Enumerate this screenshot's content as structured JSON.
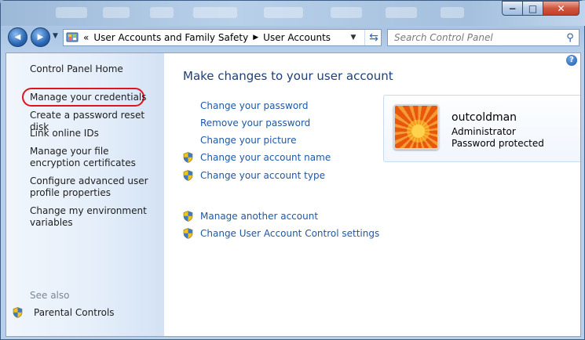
{
  "window": {
    "caption_min": "−",
    "caption_max": "□",
    "caption_close": "✕"
  },
  "nav": {
    "back_glyph": "◀",
    "forward_glyph": "▶",
    "breadcrumb_prefix": "«",
    "breadcrumb": [
      "User Accounts and Family Safety",
      "User Accounts"
    ],
    "search_placeholder": "Search Control Panel"
  },
  "sidebar": {
    "home": "Control Panel Home",
    "links": [
      "Manage your credentials",
      "Create a password reset disk",
      "Link online IDs",
      "Manage your file encryption certificates",
      "Configure advanced user profile properties",
      "Change my environment variables"
    ],
    "see_also_label": "See also",
    "parental_controls": "Parental Controls"
  },
  "main": {
    "title": "Make changes to your user account",
    "tasks": [
      {
        "label": "Change your password",
        "shield": false
      },
      {
        "label": "Remove your password",
        "shield": false
      },
      {
        "label": "Change your picture",
        "shield": false
      },
      {
        "label": "Change your account name",
        "shield": true
      },
      {
        "label": "Change your account type",
        "shield": true
      }
    ],
    "other_tasks": [
      {
        "label": "Manage another account",
        "shield": true
      },
      {
        "label": "Change User Account Control settings",
        "shield": true
      }
    ]
  },
  "account": {
    "name": "outcoldman",
    "role": "Administrator",
    "status": "Password protected"
  },
  "colors": {
    "link": "#1e58a5",
    "title": "#1e3f7a",
    "highlight": "#e0141c"
  }
}
